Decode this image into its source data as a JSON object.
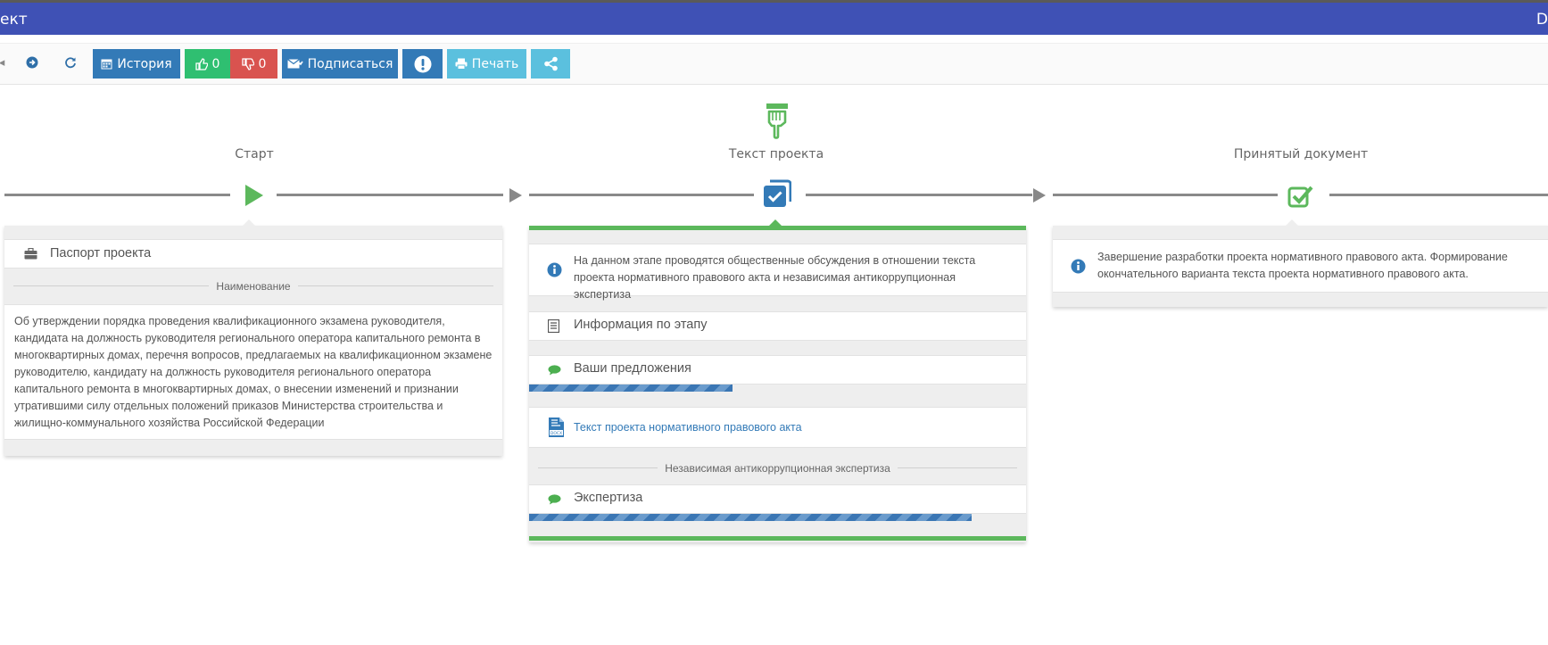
{
  "titlebar": {
    "left": "ект",
    "right": "D"
  },
  "toolbar": {
    "history": "История",
    "likes": "0",
    "dislikes": "0",
    "subscribe": "Подписаться",
    "print": "Печать"
  },
  "stages": [
    {
      "title": "Старт"
    },
    {
      "title": "Текст проекта"
    },
    {
      "title": "Принятый документ"
    }
  ],
  "start_panel": {
    "passport": "Паспорт проекта",
    "name_header": "Наименование",
    "name_text": "Об утверждении порядка проведения квалификационного экзамена руководителя, кандидата на должность руководителя регионального оператора капитального ремонта в многоквартирных домах, перечня вопросов, предлагаемых на квалификационном экзамене руководителю, кандидату на должность руководителя регионального оператора капитального ремонта в многоквартирных домах, о внесении изменений и признании утратившими силу отдельных положений приказов Министерства строительства и жилищно-коммунального хозяйства Российской Федерации"
  },
  "text_panel": {
    "info": "На данном этапе проводятся общественные обсуждения в отношении текста проекта нормативного правового акта и независимая антикоррупционная экспертиза",
    "stage_info": "Информация по этапу",
    "proposals": "Ваши предложения",
    "proposals_progress": 0.41,
    "doc_link": "Текст проекта нормативного правового акта",
    "expertise_header": "Независимая антикоррупционная экспертиза",
    "expertise": "Экспертиза",
    "expertise_progress": 0.89
  },
  "final_panel": {
    "info": "Завершение разработки проекта нормативного правового акта. Формирование окончательного варианта текста проекта нормативного правового акта."
  },
  "colors": {
    "titlebar": "#3f51b5",
    "primary_btn": "#337ab7",
    "like": "#2fbf71",
    "dislike": "#d9534f",
    "info_btn": "#5bc0de",
    "active_stage": "#5cb85c"
  }
}
